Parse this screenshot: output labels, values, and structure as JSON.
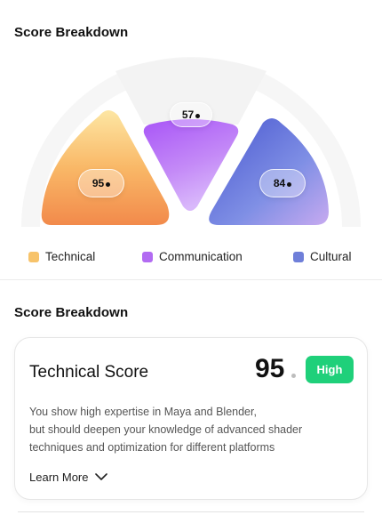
{
  "section1": {
    "title": "Score Breakdown"
  },
  "scores": {
    "technical": "95",
    "communication": "57",
    "cultural": "84"
  },
  "legend": [
    {
      "label": "Technical",
      "color": "#f7c36a"
    },
    {
      "label": "Communication",
      "color": "#b26bf2"
    },
    {
      "label": "Cultural",
      "color": "#6f7fd9"
    }
  ],
  "section2": {
    "title": "Score Breakdown"
  },
  "card": {
    "title": "Technical Score",
    "score": "95",
    "badge": "High",
    "badge_color": "#1fd07a",
    "description_lines": [
      "You show high expertise in Maya and Blender,",
      "but should deepen your knowledge of advanced shader",
      "techniques and optimization for different platforms"
    ],
    "learn_more": "Learn More",
    "learn_more_icon": "chevron-down-icon"
  }
}
